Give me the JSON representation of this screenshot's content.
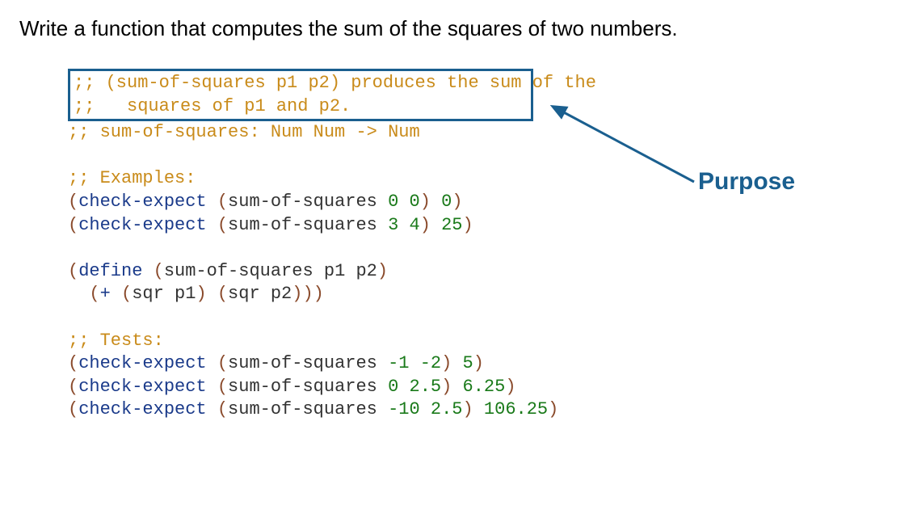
{
  "title": "Write a function that computes the sum of the squares of two numbers.",
  "callout": "Purpose",
  "code": {
    "purpose1_marker": ";;",
    "purpose1_text": " (sum-of-squares p1 p2) produces the sum of the",
    "purpose2_marker": ";;",
    "purpose2_text": "   squares of p1 and p2.",
    "contract_marker": ";;",
    "contract_text": " sum-of-squares: Num Num -> Num",
    "examples_marker": ";;",
    "examples_text": " Examples:",
    "tests_marker": ";;",
    "tests_text": " Tests:",
    "check_expect": "check-expect",
    "define": "define",
    "plus": "+",
    "sqr": "sqr",
    "sum_of_squares": "sum-of-squares",
    "p1": "p1",
    "p2": "p2",
    "n0": "0",
    "n3": "3",
    "n4": "4",
    "n25": "25",
    "nm1": "-1",
    "nm2": "-2",
    "n5": "5",
    "n2_5": "2.5",
    "n6_25": "6.25",
    "nm10": "-10",
    "n106_25": "106.25"
  }
}
